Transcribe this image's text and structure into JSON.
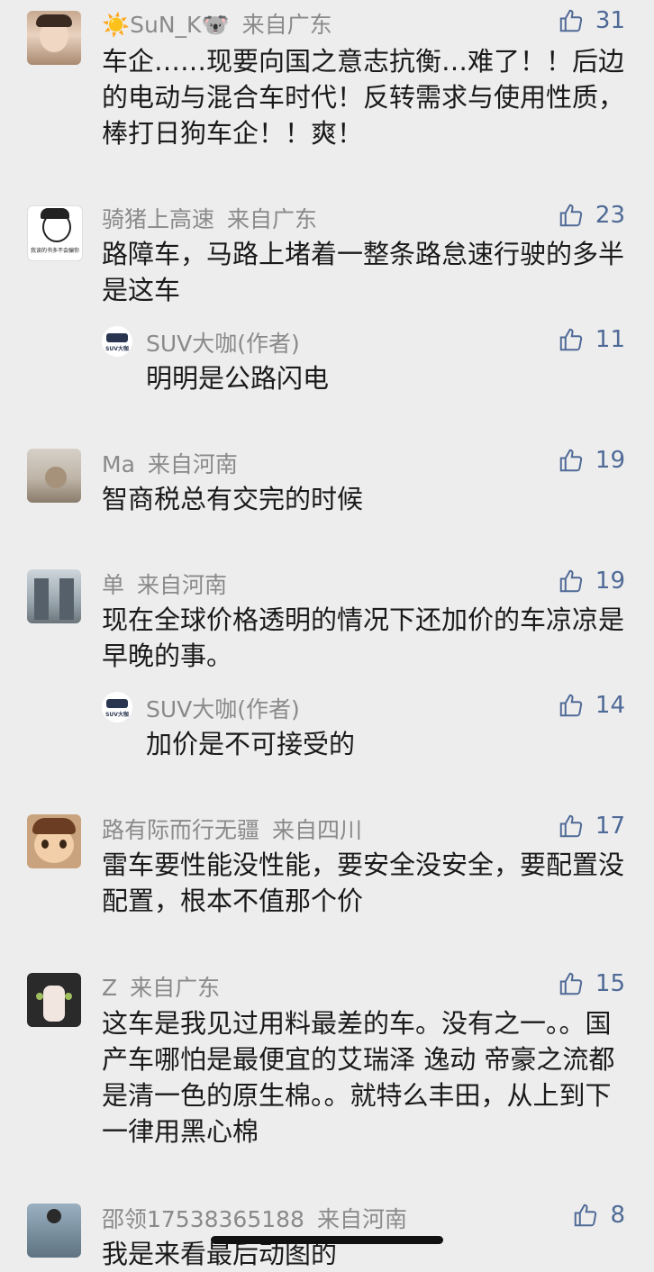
{
  "comments": [
    {
      "name": "SuN_K",
      "location": "来自广东",
      "likes": "31",
      "text": "车企……现要向国之意志抗衡…难了！！后边的电动与混合车时代！反转需求与使用性质，棒打日狗车企！！爽！",
      "prefix_emoji": "☀️",
      "suffix_emoji": "🐨"
    },
    {
      "name": "骑猪上高速",
      "location": "来自广东",
      "likes": "23",
      "text": "路障车，马路上堵着一整条路怠速行驶的多半是这车",
      "avatar_caption": "我读的书多不会骗你",
      "reply": {
        "name": "SUV大咖(作者)",
        "likes": "11",
        "text": "明明是公路闪电",
        "avatar_label": "SUV大咖"
      }
    },
    {
      "name": "Ma",
      "location": "来自河南",
      "likes": "19",
      "text": "智商税总有交完的时候"
    },
    {
      "name": "单",
      "location": "来自河南",
      "likes": "19",
      "text": "现在全球价格透明的情况下还加价的车凉凉是早晚的事。",
      "reply": {
        "name": "SUV大咖(作者)",
        "likes": "14",
        "text": "加价是不可接受的",
        "avatar_label": "SUV大咖"
      }
    },
    {
      "name": "路有际而行无疆",
      "location": "来自四川",
      "likes": "17",
      "text": "雷车要性能没性能，要安全没安全，要配置没配置，根本不值那个价"
    },
    {
      "name": "Z",
      "location": "来自广东",
      "likes": "15",
      "text": "这车是我见过用料最差的车。没有之一。。国产车哪怕是最便宜的艾瑞泽 逸动 帝豪之流都是清一色的原生棉。。就特么丰田，从上到下一律用黑心棉"
    },
    {
      "name": "邵领17538365188",
      "location": "来自河南",
      "likes": "8",
      "text": "我是来看最后动图的"
    }
  ],
  "colors": {
    "background": "#ededed",
    "name": "#8a8a8a",
    "like": "#4f6a96",
    "text": "#1a1a1a"
  }
}
